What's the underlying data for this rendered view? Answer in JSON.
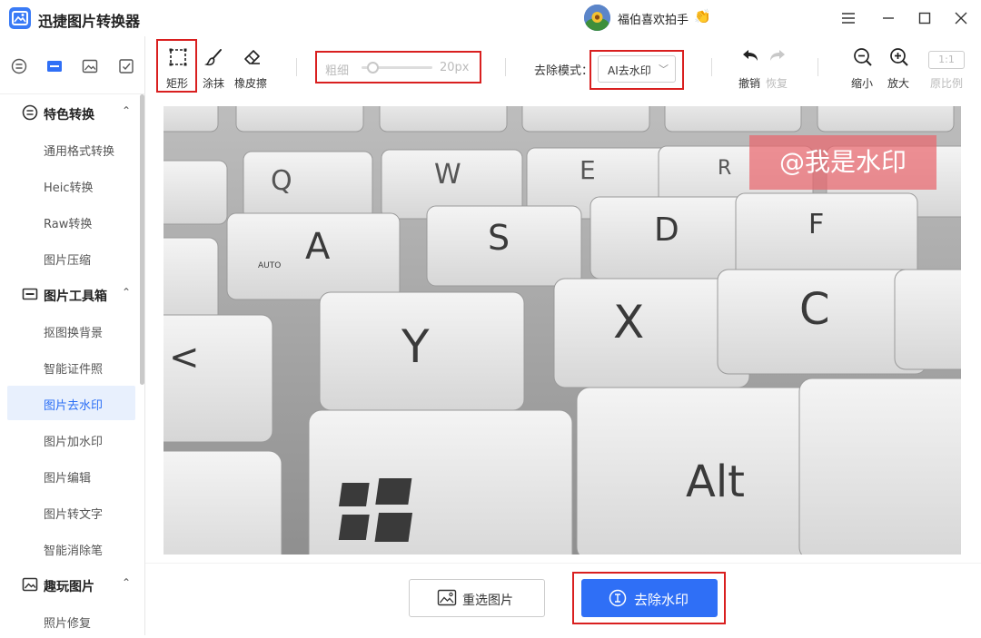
{
  "app": {
    "title": "迅捷图片转换器"
  },
  "user": {
    "name": "福伯喜欢拍手",
    "emoji": "👏"
  },
  "window_controls": [
    "menu-icon",
    "minimize-icon",
    "maximize-icon",
    "close-icon"
  ],
  "rail": {
    "icons": [
      "convert-icon",
      "toolbox-icon",
      "image-icon",
      "check-icon"
    ]
  },
  "sidebar": {
    "groups": [
      {
        "label": "特色转换",
        "icon": "convert-icon",
        "items": [
          "通用格式转换",
          "Heic转换",
          "Raw转换",
          "图片压缩"
        ]
      },
      {
        "label": "图片工具箱",
        "icon": "toolbox-icon",
        "items": [
          "抠图换背景",
          "智能证件照",
          "图片去水印",
          "图片加水印",
          "图片编辑",
          "图片转文字",
          "智能消除笔"
        ]
      },
      {
        "label": "趣玩图片",
        "icon": "image-icon",
        "items": [
          "照片修复"
        ]
      }
    ],
    "active_item": "图片去水印"
  },
  "toolbar": {
    "rect_label": "矩形",
    "smear_label": "涂抹",
    "eraser_label": "橡皮擦",
    "brush_label": "粗细",
    "brush_value": "20px",
    "mode_label": "去除模式：",
    "mode_value": "AI去水印",
    "undo_label": "撤销",
    "redo_label": "恢复",
    "zoom_out_label": "缩小",
    "zoom_in_label": "放大",
    "ratio_box": "1:1",
    "ratio_label": "原比例"
  },
  "canvas": {
    "watermark_text": "@我是水印",
    "key_labels": [
      "Q",
      "W",
      "E",
      "R",
      "A",
      "S",
      "D",
      "F",
      "Y",
      "X",
      "C",
      "Alt",
      "<",
      "AUTO"
    ]
  },
  "actions": {
    "reselect_label": "重选图片",
    "remove_label": "去除水印"
  },
  "colors": {
    "accent": "#2f6ff6",
    "highlight_box": "#d91f1f",
    "watermark": "#e9666e",
    "active_nav_bg": "#e8f0fd"
  }
}
